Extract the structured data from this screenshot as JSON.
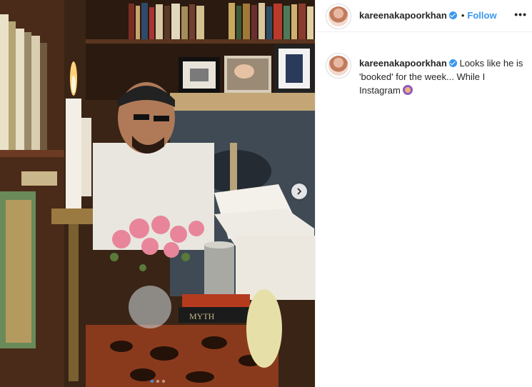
{
  "header": {
    "username": "kareenakapoorkhan",
    "separator": "•",
    "follow_label": "Follow",
    "more_label": "•••"
  },
  "caption": {
    "username": "kareenakapoorkhan",
    "text": "Looks like he is 'booked' for the week... While I Instagram"
  },
  "media": {
    "book_spine_text": "MYTH",
    "carousel_total": 3,
    "carousel_active": 1
  },
  "colors": {
    "link_blue": "#3897f0",
    "text_dark": "#262626",
    "border": "#efefef"
  },
  "icons": [
    "verified-icon",
    "chevron-right-icon",
    "more-options-icon",
    "woman-emoji-icon"
  ]
}
